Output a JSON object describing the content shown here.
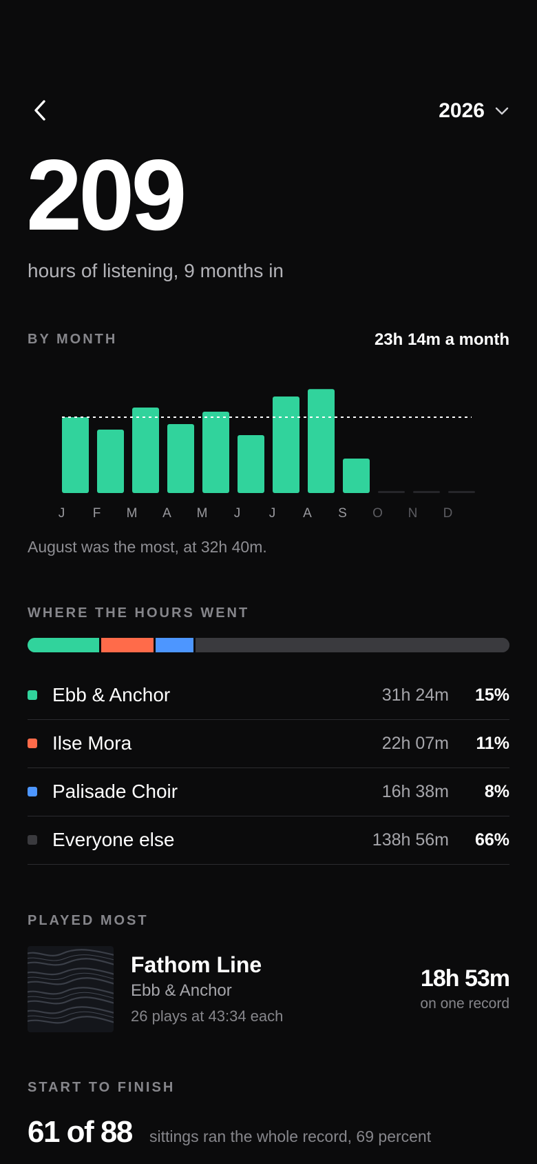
{
  "header": {
    "back_icon": "chevron-left-icon",
    "year": "2026",
    "year_icon": "chevron-down-icon"
  },
  "hero": {
    "hours": "209",
    "subtitle": "hours of listening, 9 months in"
  },
  "by_month": {
    "label": "BY MONTH",
    "average": "23h 14m a month",
    "note": "August was the most, at 32h 40m."
  },
  "chart_data": {
    "type": "bar",
    "categories": [
      "J",
      "F",
      "M",
      "A",
      "M",
      "J",
      "J",
      "A",
      "S",
      "O",
      "N",
      "D"
    ],
    "values": [
      27.5,
      23,
      31,
      25,
      29.5,
      21,
      35,
      37.7,
      12.5,
      null,
      null,
      null
    ],
    "average_line": 27.5,
    "ylim": [
      0,
      40
    ],
    "bar_color": "#31d39c",
    "empty_color": "#26262a",
    "future_label_color": "#5c5c61",
    "label_color": "#9a9a9f",
    "grid": false
  },
  "breakdown": {
    "label": "WHERE THE HOURS WENT",
    "items": [
      {
        "name": "Ebb & Anchor",
        "time": "31h 24m",
        "pct": "15%",
        "share": 15,
        "color": "#31d39c"
      },
      {
        "name": "Ilse Mora",
        "time": "22h 07m",
        "pct": "11%",
        "share": 11,
        "color": "#ff6b4a"
      },
      {
        "name": "Palisade Choir",
        "time": "16h 38m",
        "pct": "8%",
        "share": 8,
        "color": "#4d96ff"
      },
      {
        "name": "Everyone else",
        "time": "138h 56m",
        "pct": "66%",
        "share": 66,
        "color": "#3a3a3e"
      }
    ]
  },
  "played_most": {
    "label": "PLAYED MOST",
    "title": "Fathom Line",
    "artist": "Ebb & Anchor",
    "plays": "26 plays at 43:34 each",
    "time": "18h 53m",
    "caption": "on one record"
  },
  "start_to_finish": {
    "label": "START TO FINISH",
    "value": "61 of 88",
    "caption": "sittings ran the whole record, 69 percent"
  }
}
